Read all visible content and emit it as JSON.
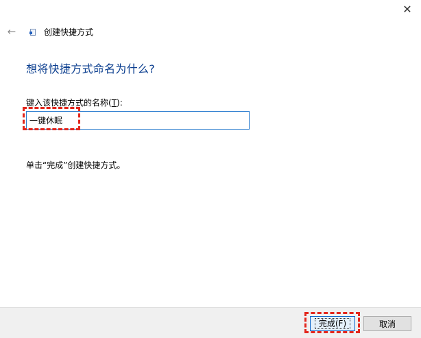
{
  "window": {
    "close_glyph": "✕"
  },
  "header": {
    "back_glyph": "←",
    "title": "创建快捷方式"
  },
  "page": {
    "heading": "想将快捷方式命名为什么?",
    "name_label_before": "键入该快捷方式的名称(",
    "name_label_accel": "T",
    "name_label_after": "):",
    "name_value": "一键休眠",
    "hint": "单击“完成”创建快捷方式。"
  },
  "footer": {
    "finish_label": "完成(F)",
    "cancel_label": "取消"
  },
  "colors": {
    "heading": "#0b3e8f",
    "highlight": "#e3261c",
    "input_border": "#2f7fd0"
  }
}
